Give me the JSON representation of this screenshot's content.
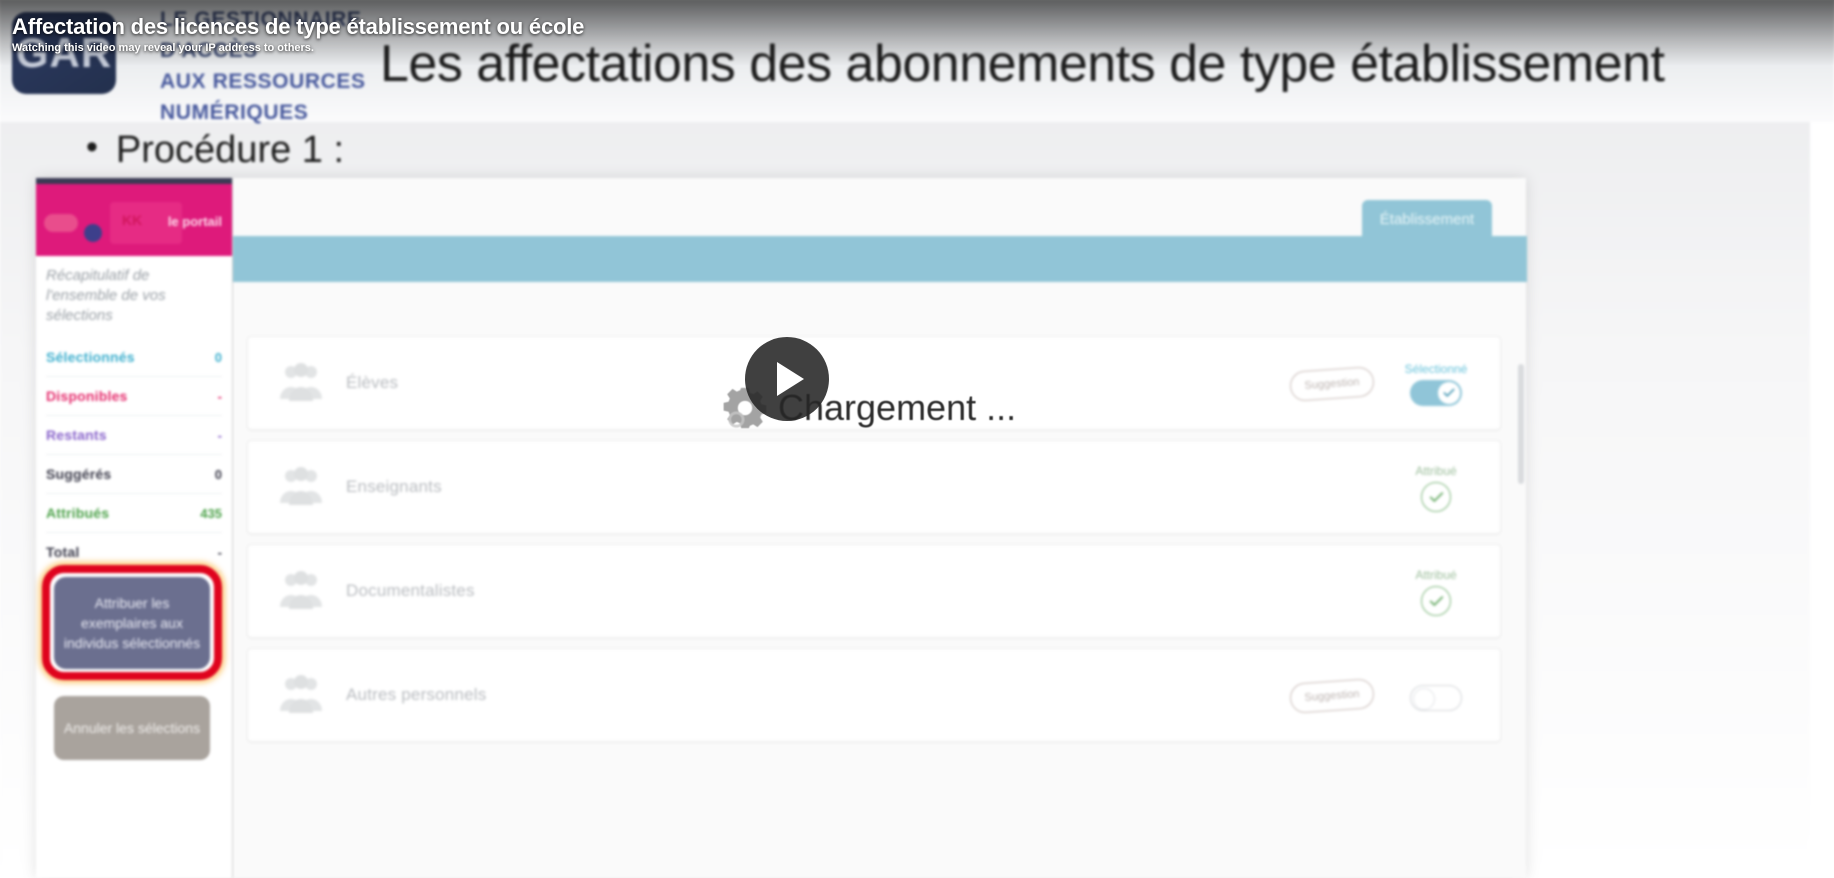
{
  "video_overlay": {
    "title": "Affectation des licences de type établissement ou école",
    "privacy_notice": "Watching this video may reveal your IP address to others.",
    "play_icon": "play-icon",
    "loading_text": "Chargement ...",
    "spinner_icon": "gear-spinner-icon"
  },
  "slide": {
    "logo_text": "GAR",
    "logo_tagline": {
      "line1": "LE GESTIONNAIRE",
      "line2": "D'ACCÈS",
      "line3": "AUX RESSOURCES",
      "line4": "NUMÉRIQUES"
    },
    "title": "Les affectations des abonnements de type établissement",
    "bullet_marker": "•",
    "bullet_text": "Procédure 1 :"
  },
  "app": {
    "sidebar": {
      "brand_portal_text": "le portail",
      "brand_badge_text": "KK",
      "recap_text": "Récapitulatif de l'ensemble de vos sélections",
      "stats": [
        {
          "label": "Sélectionnés",
          "value": "0",
          "color": "#38b0d0"
        },
        {
          "label": "Disponibles",
          "value": "-",
          "color": "#ec2a6e"
        },
        {
          "label": "Restants",
          "value": "-",
          "color": "#8a63cf"
        },
        {
          "label": "Suggérés",
          "value": "0",
          "color": "#3b3b4a"
        },
        {
          "label": "Attribués",
          "value": "435",
          "color": "#4aa447"
        },
        {
          "label": "Total",
          "value": "-",
          "color": "#3b3b4a"
        }
      ],
      "primary_button": "Attribuer les exemplaires aux individus sélectionnés",
      "secondary_button": "Annuler les sélections",
      "highlight_color": "#e8001c"
    },
    "main": {
      "tab_label": "Établissement",
      "accent_color": "#8fc6d8",
      "rows": [
        {
          "label": "Élèves",
          "icon": "people-group-icon",
          "badge": "Suggestion",
          "state_label": "Sélectionné",
          "control": "toggle-on"
        },
        {
          "label": "Enseignants",
          "icon": "people-group-icon",
          "badge": "",
          "state_label": "Attribué",
          "control": "check-circle"
        },
        {
          "label": "Documentalistes",
          "icon": "people-group-icon",
          "badge": "",
          "state_label": "Attribué",
          "control": "check-circle"
        },
        {
          "label": "Autres personnels",
          "icon": "people-group-icon",
          "badge": "Suggestion",
          "state_label": "",
          "control": "toggle-off"
        }
      ]
    }
  }
}
